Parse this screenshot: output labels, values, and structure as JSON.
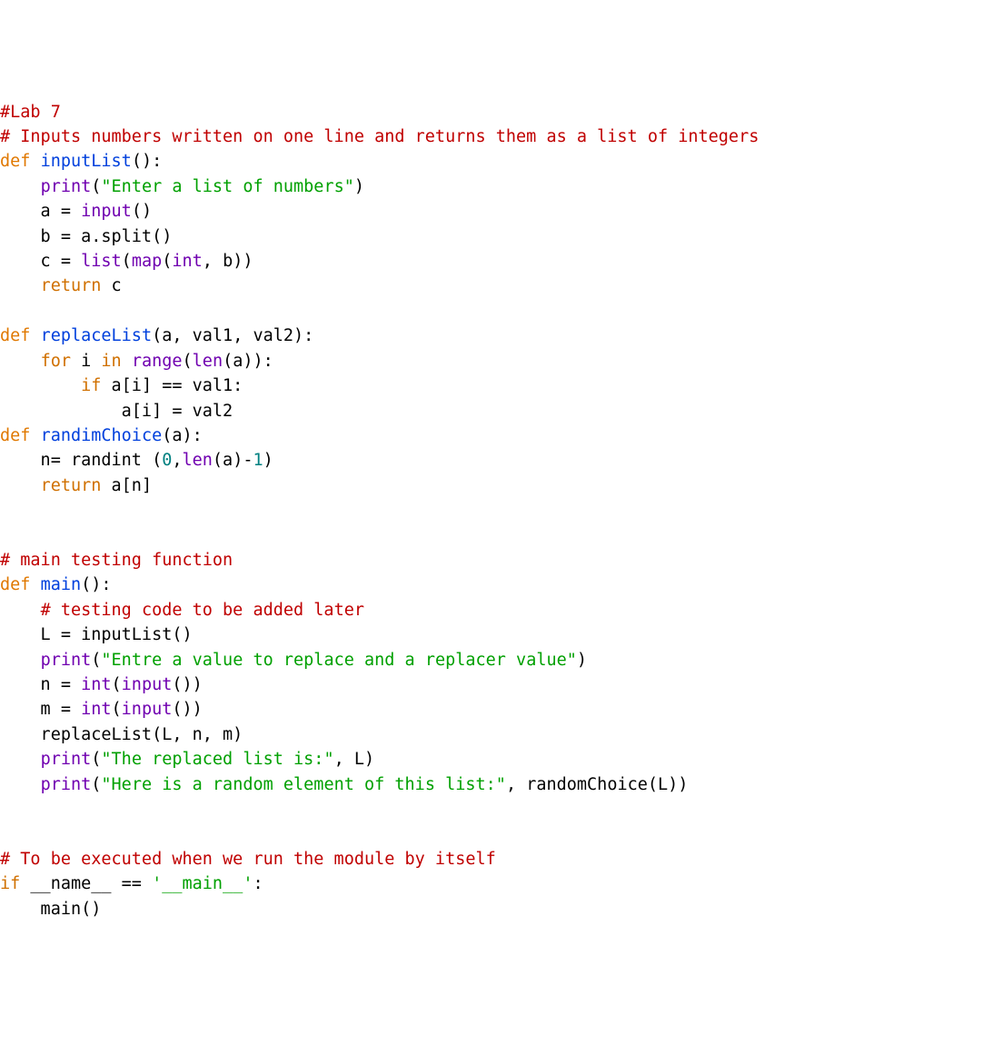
{
  "code": {
    "lines": [
      [
        {
          "cls": "t-comment",
          "text": "#Lab 7"
        }
      ],
      [
        {
          "cls": "t-comment",
          "text": "# Inputs numbers written on one line and returns them as a list of integers"
        }
      ],
      [
        {
          "cls": "t-def",
          "text": "def "
        },
        {
          "cls": "t-fn",
          "text": "inputList"
        },
        {
          "cls": "t-plain",
          "text": "():"
        }
      ],
      [
        {
          "cls": "t-plain",
          "text": "    "
        },
        {
          "cls": "t-builtin",
          "text": "print"
        },
        {
          "cls": "t-plain",
          "text": "("
        },
        {
          "cls": "t-str",
          "text": "\"Enter a list of numbers\""
        },
        {
          "cls": "t-plain",
          "text": ")"
        }
      ],
      [
        {
          "cls": "t-plain",
          "text": "    a = "
        },
        {
          "cls": "t-builtin",
          "text": "input"
        },
        {
          "cls": "t-plain",
          "text": "()"
        }
      ],
      [
        {
          "cls": "t-plain",
          "text": "    b = a.split()"
        }
      ],
      [
        {
          "cls": "t-plain",
          "text": "    c = "
        },
        {
          "cls": "t-builtin",
          "text": "list"
        },
        {
          "cls": "t-plain",
          "text": "("
        },
        {
          "cls": "t-builtin",
          "text": "map"
        },
        {
          "cls": "t-plain",
          "text": "("
        },
        {
          "cls": "t-builtin",
          "text": "int"
        },
        {
          "cls": "t-plain",
          "text": ", b))"
        }
      ],
      [
        {
          "cls": "t-plain",
          "text": "    "
        },
        {
          "cls": "t-kw",
          "text": "return"
        },
        {
          "cls": "t-plain",
          "text": " c"
        }
      ],
      [
        {
          "cls": "t-plain",
          "text": ""
        }
      ],
      [
        {
          "cls": "t-def",
          "text": "def "
        },
        {
          "cls": "t-fn",
          "text": "replaceList"
        },
        {
          "cls": "t-plain",
          "text": "(a, val1, val2):"
        }
      ],
      [
        {
          "cls": "t-plain",
          "text": "    "
        },
        {
          "cls": "t-kw",
          "text": "for"
        },
        {
          "cls": "t-plain",
          "text": " i "
        },
        {
          "cls": "t-kw",
          "text": "in"
        },
        {
          "cls": "t-plain",
          "text": " "
        },
        {
          "cls": "t-builtin",
          "text": "range"
        },
        {
          "cls": "t-plain",
          "text": "("
        },
        {
          "cls": "t-builtin",
          "text": "len"
        },
        {
          "cls": "t-plain",
          "text": "(a)):"
        }
      ],
      [
        {
          "cls": "t-plain",
          "text": "        "
        },
        {
          "cls": "t-kw",
          "text": "if"
        },
        {
          "cls": "t-plain",
          "text": " a[i] == val1:"
        }
      ],
      [
        {
          "cls": "t-plain",
          "text": "            a[i] = val2"
        }
      ],
      [
        {
          "cls": "t-def",
          "text": "def "
        },
        {
          "cls": "t-fn",
          "text": "randimChoice"
        },
        {
          "cls": "t-plain",
          "text": "(a):"
        }
      ],
      [
        {
          "cls": "t-plain",
          "text": "    n= randint ("
        },
        {
          "cls": "t-num",
          "text": "0"
        },
        {
          "cls": "t-plain",
          "text": ","
        },
        {
          "cls": "t-builtin",
          "text": "len"
        },
        {
          "cls": "t-plain",
          "text": "(a)-"
        },
        {
          "cls": "t-num",
          "text": "1"
        },
        {
          "cls": "t-plain",
          "text": ")"
        }
      ],
      [
        {
          "cls": "t-plain",
          "text": "    "
        },
        {
          "cls": "t-kw",
          "text": "return"
        },
        {
          "cls": "t-plain",
          "text": " a[n]"
        }
      ],
      [
        {
          "cls": "t-plain",
          "text": ""
        }
      ],
      [
        {
          "cls": "t-plain",
          "text": ""
        }
      ],
      [
        {
          "cls": "t-comment",
          "text": "# main testing function"
        }
      ],
      [
        {
          "cls": "t-def",
          "text": "def "
        },
        {
          "cls": "t-fn",
          "text": "main"
        },
        {
          "cls": "t-plain",
          "text": "():"
        }
      ],
      [
        {
          "cls": "t-plain",
          "text": "    "
        },
        {
          "cls": "t-comment",
          "text": "# testing code to be added later"
        }
      ],
      [
        {
          "cls": "t-plain",
          "text": "    L = inputList()"
        }
      ],
      [
        {
          "cls": "t-plain",
          "text": "    "
        },
        {
          "cls": "t-builtin",
          "text": "print"
        },
        {
          "cls": "t-plain",
          "text": "("
        },
        {
          "cls": "t-str",
          "text": "\"Entre a value to replace and a replacer value\""
        },
        {
          "cls": "t-plain",
          "text": ")"
        }
      ],
      [
        {
          "cls": "t-plain",
          "text": "    n = "
        },
        {
          "cls": "t-builtin",
          "text": "int"
        },
        {
          "cls": "t-plain",
          "text": "("
        },
        {
          "cls": "t-builtin",
          "text": "input"
        },
        {
          "cls": "t-plain",
          "text": "())"
        }
      ],
      [
        {
          "cls": "t-plain",
          "text": "    m = "
        },
        {
          "cls": "t-builtin",
          "text": "int"
        },
        {
          "cls": "t-plain",
          "text": "("
        },
        {
          "cls": "t-builtin",
          "text": "input"
        },
        {
          "cls": "t-plain",
          "text": "())"
        }
      ],
      [
        {
          "cls": "t-plain",
          "text": "    replaceList(L, n, m)"
        }
      ],
      [
        {
          "cls": "t-plain",
          "text": "    "
        },
        {
          "cls": "t-builtin",
          "text": "print"
        },
        {
          "cls": "t-plain",
          "text": "("
        },
        {
          "cls": "t-str",
          "text": "\"The replaced list is:\""
        },
        {
          "cls": "t-plain",
          "text": ", L)"
        }
      ],
      [
        {
          "cls": "t-plain",
          "text": "    "
        },
        {
          "cls": "t-builtin",
          "text": "print"
        },
        {
          "cls": "t-plain",
          "text": "("
        },
        {
          "cls": "t-str",
          "text": "\"Here is a random element of this list:\""
        },
        {
          "cls": "t-plain",
          "text": ", randomChoice(L))"
        }
      ],
      [
        {
          "cls": "t-plain",
          "text": ""
        }
      ],
      [
        {
          "cls": "t-plain",
          "text": ""
        }
      ],
      [
        {
          "cls": "t-comment",
          "text": "# To be executed when we run the module by itself"
        }
      ],
      [
        {
          "cls": "t-kw",
          "text": "if"
        },
        {
          "cls": "t-plain",
          "text": " __name__ == "
        },
        {
          "cls": "t-str",
          "text": "'__main__'"
        },
        {
          "cls": "t-plain",
          "text": ":"
        }
      ],
      [
        {
          "cls": "t-plain",
          "text": "    main()"
        }
      ]
    ]
  }
}
